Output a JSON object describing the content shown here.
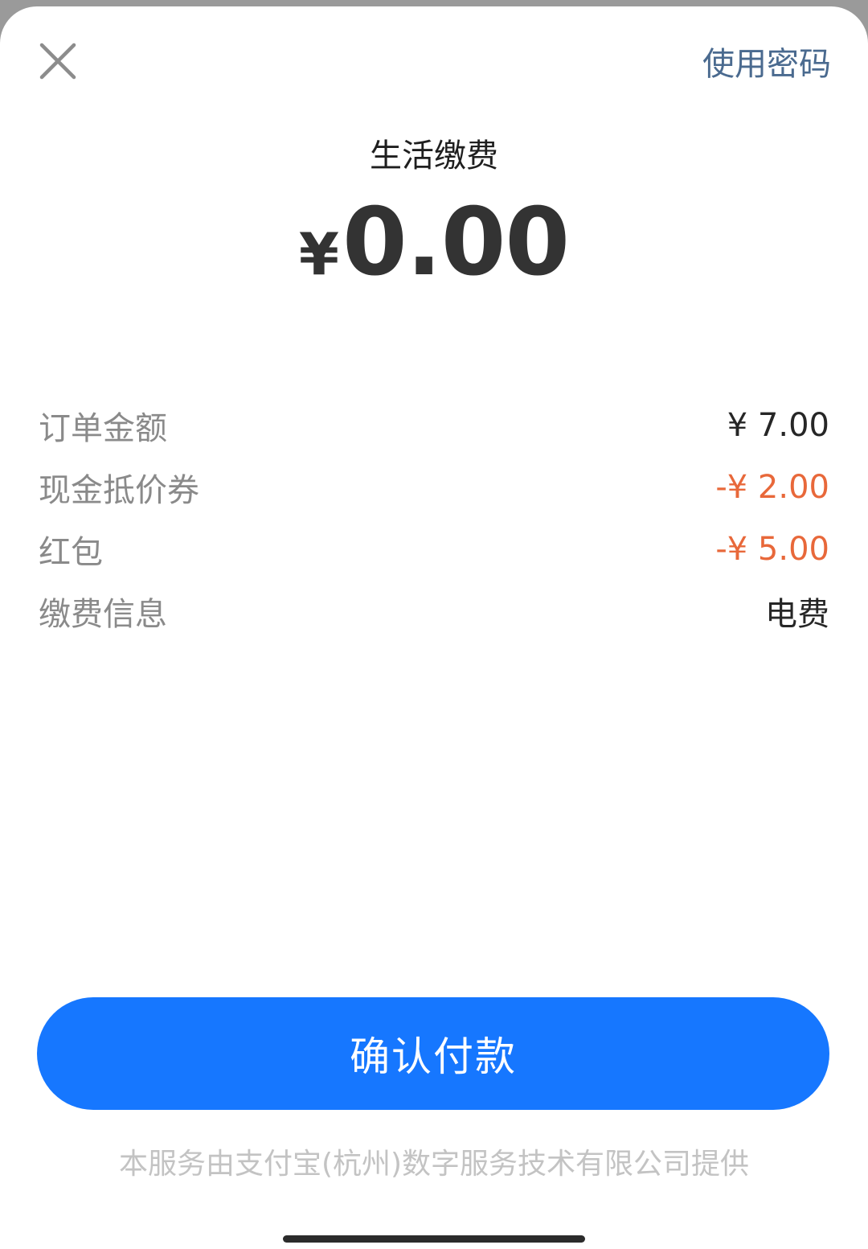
{
  "header": {
    "close_icon": "close-icon",
    "use_password_label": "使用密码"
  },
  "payment": {
    "merchant_title": "生活缴费",
    "currency_symbol": "¥",
    "amount": "0.00"
  },
  "details": [
    {
      "label": "订单金额",
      "value": "¥ 7.00",
      "is_discount": false
    },
    {
      "label": "现金抵价券",
      "value": "-¥ 2.00",
      "is_discount": true
    },
    {
      "label": "红包",
      "value": "-¥ 5.00",
      "is_discount": true
    },
    {
      "label": "缴费信息",
      "value": "电费",
      "is_discount": false
    }
  ],
  "footer": {
    "confirm_label": "确认付款",
    "provider_note": "本服务由支付宝(杭州)数字服务技术有限公司提供"
  },
  "colors": {
    "accent": "#1677ff",
    "discount": "#e8683a",
    "link": "#4a6a8f"
  }
}
